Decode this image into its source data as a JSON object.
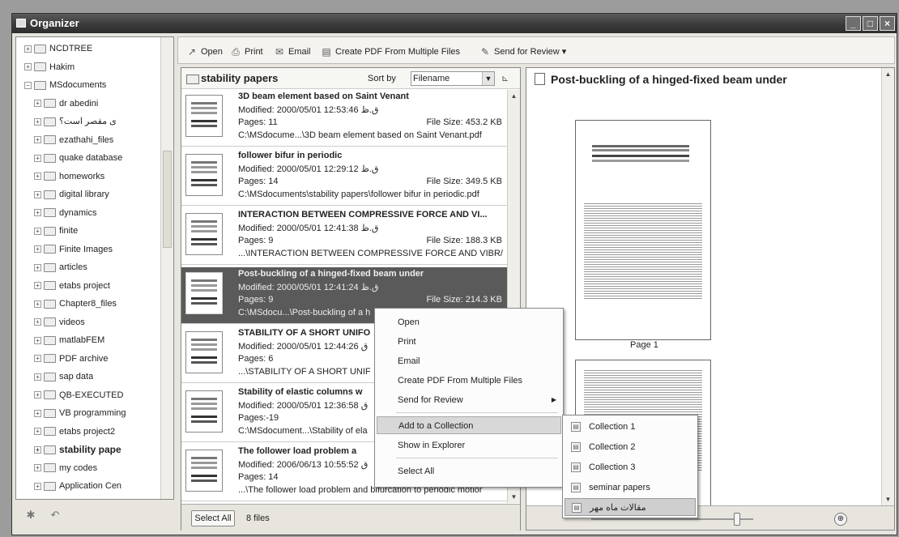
{
  "window": {
    "title": "Organizer"
  },
  "tree": {
    "items": [
      {
        "label": "NCDTREE",
        "indent": 1
      },
      {
        "label": "Hakim",
        "indent": 1
      },
      {
        "label": "MSdocuments",
        "indent": 1,
        "expanded": true
      },
      {
        "label": "dr abedini",
        "indent": 2
      },
      {
        "label": "ی مقصر است؟",
        "indent": 2
      },
      {
        "label": "ezathahi_files",
        "indent": 2
      },
      {
        "label": "quake database",
        "indent": 2
      },
      {
        "label": "homeworks",
        "indent": 2
      },
      {
        "label": "digital library",
        "indent": 2
      },
      {
        "label": "dynamics",
        "indent": 2
      },
      {
        "label": "finite",
        "indent": 2
      },
      {
        "label": "Finite Images",
        "indent": 2
      },
      {
        "label": "articles",
        "indent": 2
      },
      {
        "label": "etabs project",
        "indent": 2
      },
      {
        "label": "Chapter8_files",
        "indent": 2
      },
      {
        "label": "videos",
        "indent": 2
      },
      {
        "label": "matlabFEM",
        "indent": 2
      },
      {
        "label": "PDF archive",
        "indent": 2
      },
      {
        "label": "sap data",
        "indent": 2
      },
      {
        "label": "QB-EXECUTED",
        "indent": 2
      },
      {
        "label": "VB programming",
        "indent": 2
      },
      {
        "label": "etabs project2",
        "indent": 2
      },
      {
        "label": "stability pape",
        "indent": 2,
        "bold": true
      },
      {
        "label": "my codes",
        "indent": 2
      },
      {
        "label": "Application Cen",
        "indent": 2
      }
    ]
  },
  "toolbar": {
    "open": "Open",
    "print": "Print",
    "email": "Email",
    "create_pdf": "Create PDF From Multiple Files",
    "send_review": "Send for Review"
  },
  "list": {
    "collection_title": "stability papers",
    "sort_by_label": "Sort by",
    "sort_value": "Filename",
    "files": [
      {
        "title": "3D beam element based on Saint Venant",
        "modified": "Modified: 2000/05/01 12:53:46 ق.ظ",
        "pages": "Pages: 11",
        "size": "File Size: 453.2 KB",
        "path": "C:\\MSdocume...\\3D beam element based on Saint Venant.pdf"
      },
      {
        "title": "follower bifur in periodic",
        "modified": "Modified: 2000/05/01 12:29:12 ق.ظ",
        "pages": "Pages: 14",
        "size": "File Size: 349.5 KB",
        "path": "C:\\MSdocuments\\stability papers\\follower bifur in periodic.pdf"
      },
      {
        "title": "INTERACTION BETWEEN COMPRESSIVE FORCE AND VI...",
        "modified": "Modified: 2000/05/01 12:41:38 ق.ظ",
        "pages": "Pages: 9",
        "size": "File Size: 188.3 KB",
        "path": "...\\INTERACTION BETWEEN COMPRESSIVE FORCE AND VIBR/"
      },
      {
        "title": "Post-buckling of a hinged-fixed beam under",
        "modified": "Modified: 2000/05/01 12:41:24 ق.ظ",
        "pages": "Pages: 9",
        "size": "File Size: 214.3 KB",
        "path": "C:\\MSdocu...\\Post-buckling of a h"
      },
      {
        "title": "STABILITY OF A SHORT UNIFO",
        "modified": "Modified: 2000/05/01 12:44:26 ق",
        "pages": "Pages: 6",
        "size": "",
        "path": "...\\STABILITY OF A SHORT UNIF"
      },
      {
        "title": "Stability of elastic columns w",
        "modified": "Modified: 2000/05/01 12:36:58 ق",
        "pages": "Pages:-19",
        "size": "",
        "path": "C:\\MSdocument...\\Stability of ela"
      },
      {
        "title": "The follower load problem a",
        "modified": "Modified: 2006/06/13 10:55:52 ق",
        "pages": "Pages: 14",
        "size": "",
        "path": "...\\The follower load problem and bifurcation to periodic motior"
      }
    ],
    "select_all": "Select All",
    "count": "8 files"
  },
  "preview": {
    "title": "Post-buckling of a hinged-fixed beam under",
    "page_label": "Page 1",
    "zoom_level": 0.9
  },
  "context_menu": {
    "items": [
      "Open",
      "Print",
      "Email",
      "Create PDF From Multiple Files",
      "Send for Review",
      "Add to a Collection",
      "Show in Explorer",
      "Select All"
    ]
  },
  "collection_menu": {
    "items": [
      "Collection 1",
      "Collection 2",
      "Collection 3",
      "seminar papers",
      "مقالات ماه مهر"
    ]
  }
}
